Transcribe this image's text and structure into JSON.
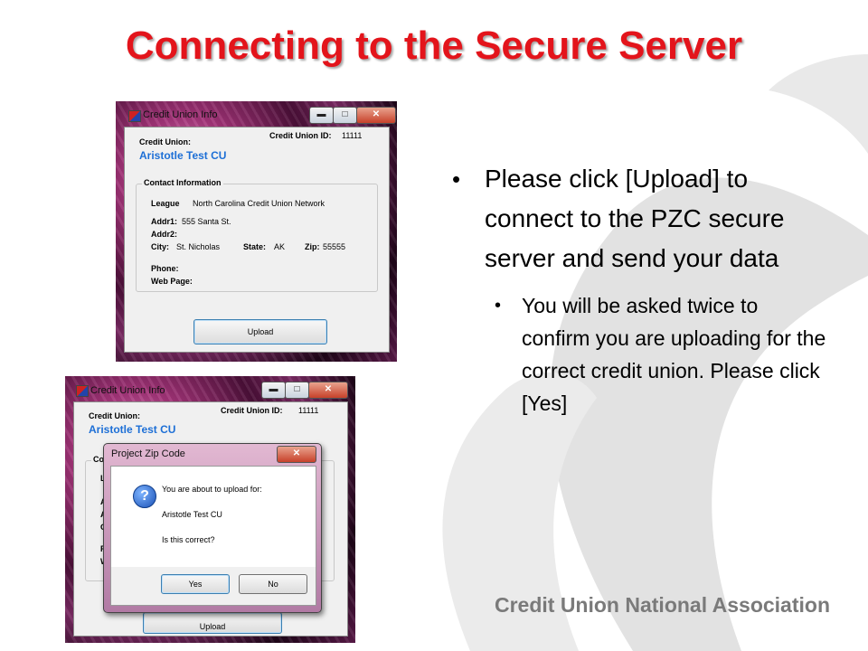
{
  "slide": {
    "title": "Connecting to the Secure Server",
    "footer": "Credit Union National Association"
  },
  "bullets": {
    "main": "Please click [Upload] to connect to the PZC secure server and send your data",
    "sub": "You will be asked twice to confirm you are uploading for the correct credit union. Please click [Yes]"
  },
  "window": {
    "title": "Credit Union Info",
    "min_glyph": "▬",
    "max_glyph": "□",
    "close_glyph": "✕",
    "credit_union_label": "Credit Union:",
    "credit_union_name": "Aristotle Test CU",
    "cu_id_label": "Credit Union ID:",
    "cu_id_value": "11111",
    "contact_group": "Contact Information",
    "league_label": "League",
    "league_value": "North Carolina Credit Union Network",
    "addr1_label": "Addr1:",
    "addr1_value": "555 Santa St.",
    "addr2_label": "Addr2:",
    "city_label": "City:",
    "city_value": "St. Nicholas",
    "state_label": "State:",
    "state_value": "AK",
    "zip_label": "Zip:",
    "zip_value": "55555",
    "phone_label": "Phone:",
    "web_label": "Web Page:",
    "upload_label": "Upload"
  },
  "window2": {
    "partial_labels": [
      "Co",
      "L",
      "A",
      "A",
      "C",
      "P",
      "W"
    ]
  },
  "dialog": {
    "title": "Project Zip Code",
    "close_glyph": "✕",
    "icon_glyph": "?",
    "line1": "You are about to upload for:",
    "line2": "Aristotle Test CU",
    "line3": "Is this correct?",
    "yes_label": "Yes",
    "no_label": "No"
  },
  "colors": {
    "title_red": "#e3141b",
    "footer_gray": "#7a7a7a",
    "cu_name_blue": "#1d6fd6"
  }
}
